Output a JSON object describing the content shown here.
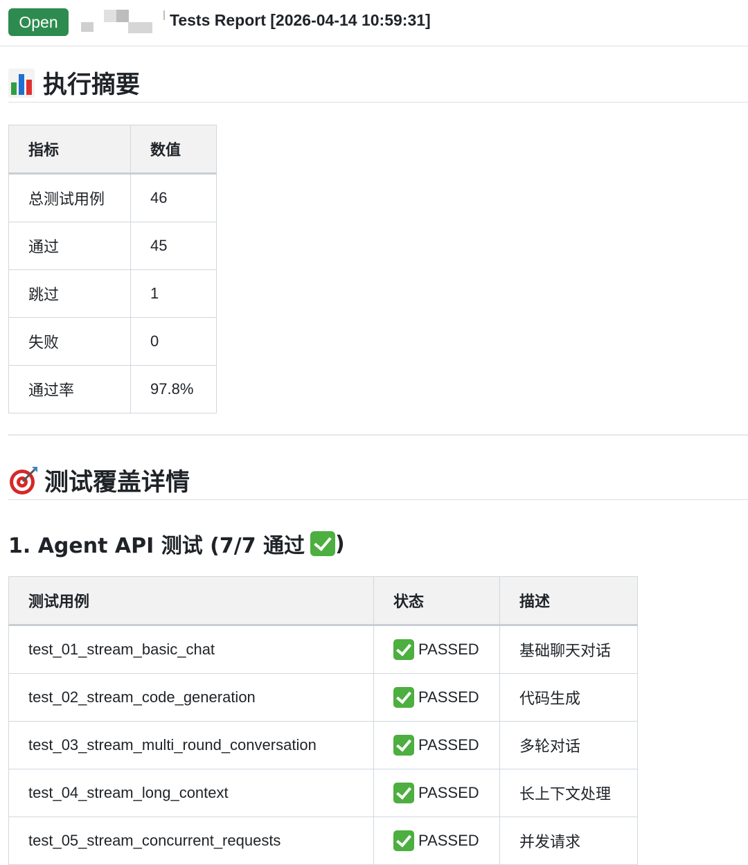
{
  "header": {
    "badge_label": "Open",
    "title": "Tests Report [2026-04-14 10:59:31]"
  },
  "summary": {
    "heading": "执行摘要",
    "columns": [
      "指标",
      "数值"
    ],
    "rows": [
      [
        "总测试用例",
        "46"
      ],
      [
        "通过",
        "45"
      ],
      [
        "跳过",
        "1"
      ],
      [
        "失败",
        "0"
      ],
      [
        "通过率",
        "97.8%"
      ]
    ]
  },
  "coverage": {
    "heading": "测试覆盖详情",
    "subsection_label": "1. Agent API 测试 (7/7 通过",
    "subsection_close": ")",
    "columns": [
      "测试用例",
      "状态",
      "描述"
    ],
    "rows": [
      {
        "name": "test_01_stream_basic_chat",
        "status": "PASSED",
        "desc": "基础聊天对话"
      },
      {
        "name": "test_02_stream_code_generation",
        "status": "PASSED",
        "desc": "代码生成"
      },
      {
        "name": "test_03_stream_multi_round_conversation",
        "status": "PASSED",
        "desc": "多轮对话"
      },
      {
        "name": "test_04_stream_long_context",
        "status": "PASSED",
        "desc": "长上下文处理"
      },
      {
        "name": "test_05_stream_concurrent_requests",
        "status": "PASSED",
        "desc": "并发请求"
      }
    ]
  },
  "colors": {
    "badge_green": "#2e8b4f",
    "check_green": "#4caf3f",
    "header_bg": "#f2f2f2",
    "border": "#d0d7de"
  },
  "icons": {
    "summary": "bar-chart-icon",
    "coverage": "target-icon",
    "status": "check-mark-icon"
  }
}
